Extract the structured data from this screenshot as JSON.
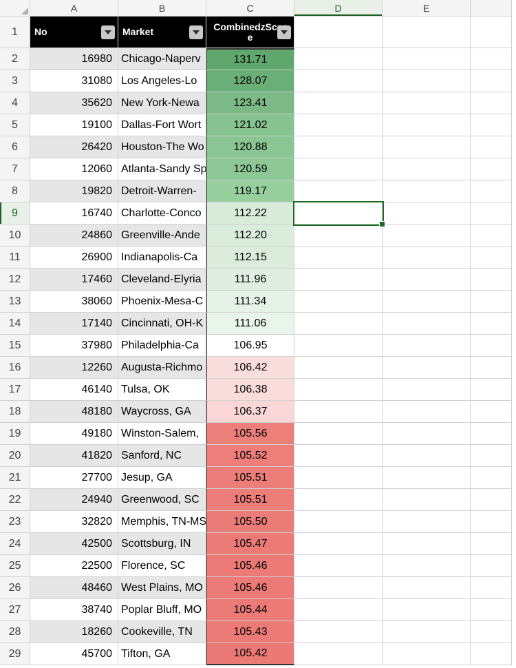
{
  "column_letters": [
    "A",
    "B",
    "C",
    "D",
    "E",
    ""
  ],
  "selected_column_index": 3,
  "selected_row_number": 9,
  "headers": {
    "A": "No",
    "B": "Market",
    "C": "CombinedzScore"
  },
  "rows": [
    {
      "no": 16980,
      "market": "Chicago-Naperv",
      "score": "131.71",
      "c": "#5fa76d"
    },
    {
      "no": 31080,
      "market": "Los Angeles-Lo",
      "score": "128.07",
      "c": "#6aaf77"
    },
    {
      "no": 35620,
      "market": "New York-Newa",
      "score": "123.41",
      "c": "#7bba87"
    },
    {
      "no": 19100,
      "market": "Dallas-Fort Wort",
      "score": "121.02",
      "c": "#87c291"
    },
    {
      "no": 26420,
      "market": "Houston-The Wo",
      "score": "120.88",
      "c": "#8ac594"
    },
    {
      "no": 12060,
      "market": "Atlanta-Sandy Sp",
      "score": "120.59",
      "c": "#8dc796"
    },
    {
      "no": 19820,
      "market": "Detroit-Warren-",
      "score": "119.17",
      "c": "#98cf9f"
    },
    {
      "no": 16740,
      "market": "Charlotte-Conco",
      "score": "112.22",
      "c": "#d9ebdb"
    },
    {
      "no": 24860,
      "market": "Greenville-Ande",
      "score": "112.20",
      "c": "#daecdc"
    },
    {
      "no": 26900,
      "market": "Indianapolis-Ca",
      "score": "112.15",
      "c": "#dbecdd"
    },
    {
      "no": 17460,
      "market": "Cleveland-Elyria",
      "score": "111.96",
      "c": "#dfeee0"
    },
    {
      "no": 38060,
      "market": "Phoenix-Mesa-C",
      "score": "111.34",
      "c": "#e6f2e7"
    },
    {
      "no": 17140,
      "market": "Cincinnati, OH-K",
      "score": "111.06",
      "c": "#e9f4ea"
    },
    {
      "no": 37980,
      "market": "Philadelphia-Ca",
      "score": "106.95",
      "c": "#ffffff"
    },
    {
      "no": 12260,
      "market": "Augusta-Richmo",
      "score": "106.42",
      "c": "#fadedd"
    },
    {
      "no": 46140,
      "market": "Tulsa, OK",
      "score": "106.38",
      "c": "#fadcdb"
    },
    {
      "no": 48180,
      "market": "Waycross, GA",
      "score": "106.37",
      "c": "#fad7d6"
    },
    {
      "no": 49180,
      "market": "Winston-Salem,",
      "score": "105.56",
      "c": "#ed7f7b"
    },
    {
      "no": 41820,
      "market": "Sanford, NC",
      "score": "105.52",
      "c": "#ed7e7a"
    },
    {
      "no": 27700,
      "market": "Jesup, GA",
      "score": "105.51",
      "c": "#ed7d79"
    },
    {
      "no": 24940,
      "market": "Greenwood, SC",
      "score": "105.51",
      "c": "#ed7d79"
    },
    {
      "no": 32820,
      "market": "Memphis, TN-MS",
      "score": "105.50",
      "c": "#ec7c78"
    },
    {
      "no": 42500,
      "market": "Scottsburg, IN",
      "score": "105.47",
      "c": "#ec7b77"
    },
    {
      "no": 22500,
      "market": "Florence, SC",
      "score": "105.46",
      "c": "#ec7b77"
    },
    {
      "no": 48460,
      "market": "West Plains, MO",
      "score": "105.46",
      "c": "#ec7b77"
    },
    {
      "no": 38740,
      "market": "Poplar Bluff, MO",
      "score": "105.44",
      "c": "#ec7a76"
    },
    {
      "no": 18260,
      "market": "Cookeville, TN",
      "score": "105.43",
      "c": "#ec7a76"
    },
    {
      "no": 45700,
      "market": "Tifton, GA",
      "score": "105.42",
      "c": "#eb7975"
    }
  ],
  "row_count": 28
}
